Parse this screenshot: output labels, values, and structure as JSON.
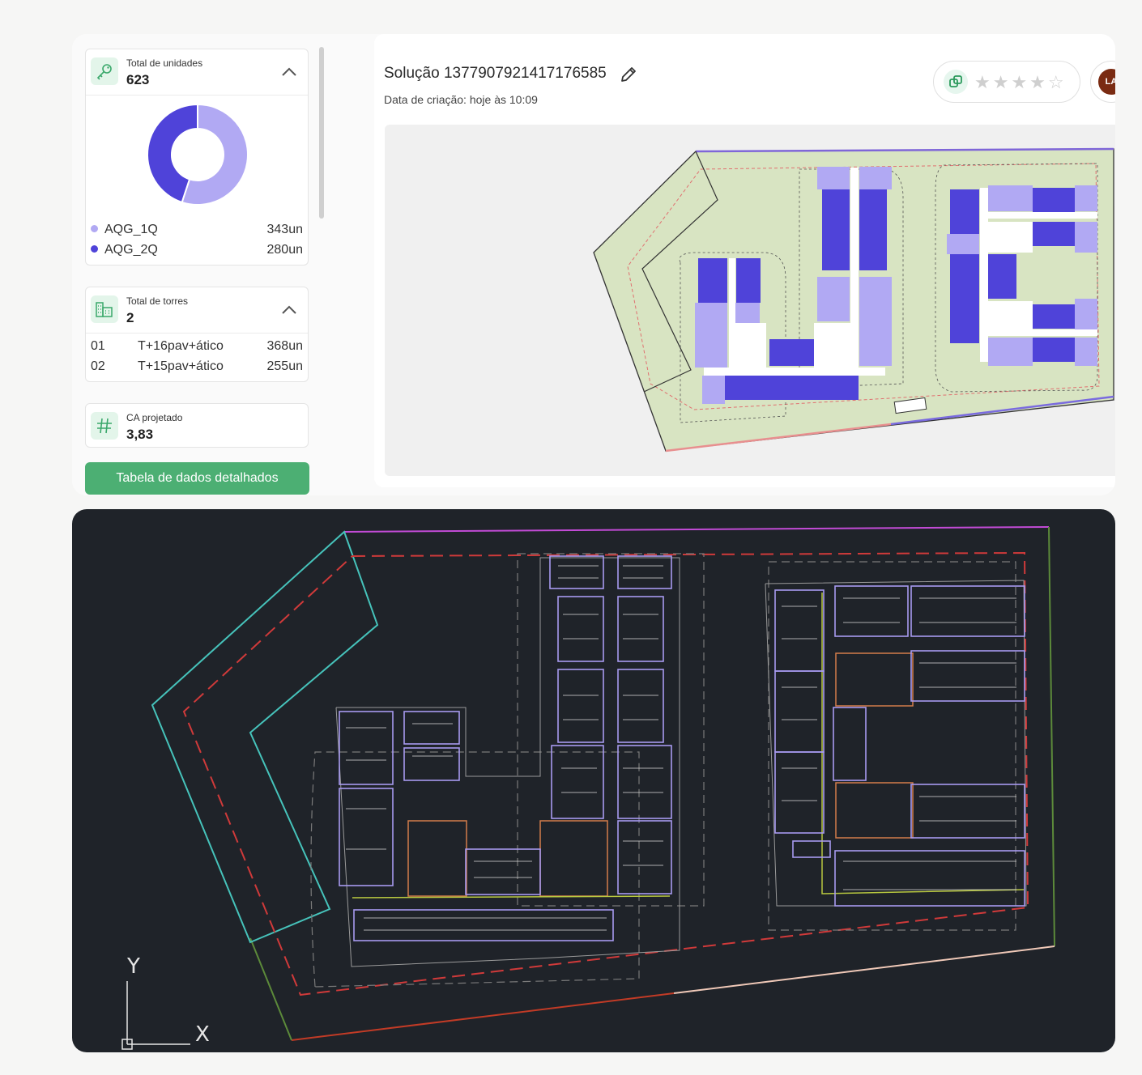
{
  "units_panel": {
    "label": "Total de unidades",
    "value": "623",
    "legend": [
      {
        "name": "AQG_1Q",
        "value": "343un",
        "color": "#b1a9f3"
      },
      {
        "name": "AQG_2Q",
        "value": "280un",
        "color": "#4f43d9"
      }
    ]
  },
  "units_donut": {
    "type": "pie",
    "categories": [
      "AQG_1Q",
      "AQG_2Q"
    ],
    "values": [
      343,
      280
    ],
    "colors": [
      "#b1a9f3",
      "#4f43d9"
    ]
  },
  "towers_panel": {
    "label": "Total de torres",
    "value": "2",
    "rows": [
      {
        "id": "01",
        "desc": "T+16pav+ático",
        "units": "368un"
      },
      {
        "id": "02",
        "desc": "T+15pav+ático",
        "units": "255un"
      }
    ]
  },
  "ca_panel": {
    "label": "CA projetado",
    "value": "3,83"
  },
  "detail_button_label": "Tabela de dados detalhados",
  "solution": {
    "title": "Solução 1377907921417176585",
    "date": "Data de criação: hoje às 10:09"
  },
  "rating": {
    "stars": "★★★★☆"
  },
  "avatar_initials": "LA",
  "cad_axis": {
    "y": "Y",
    "x": "X"
  },
  "colors": {
    "accent_green": "#4caf73",
    "unit_light": "#b1a9f3",
    "unit_dark": "#4f43d9",
    "site_fill": "#d8e4c2"
  }
}
